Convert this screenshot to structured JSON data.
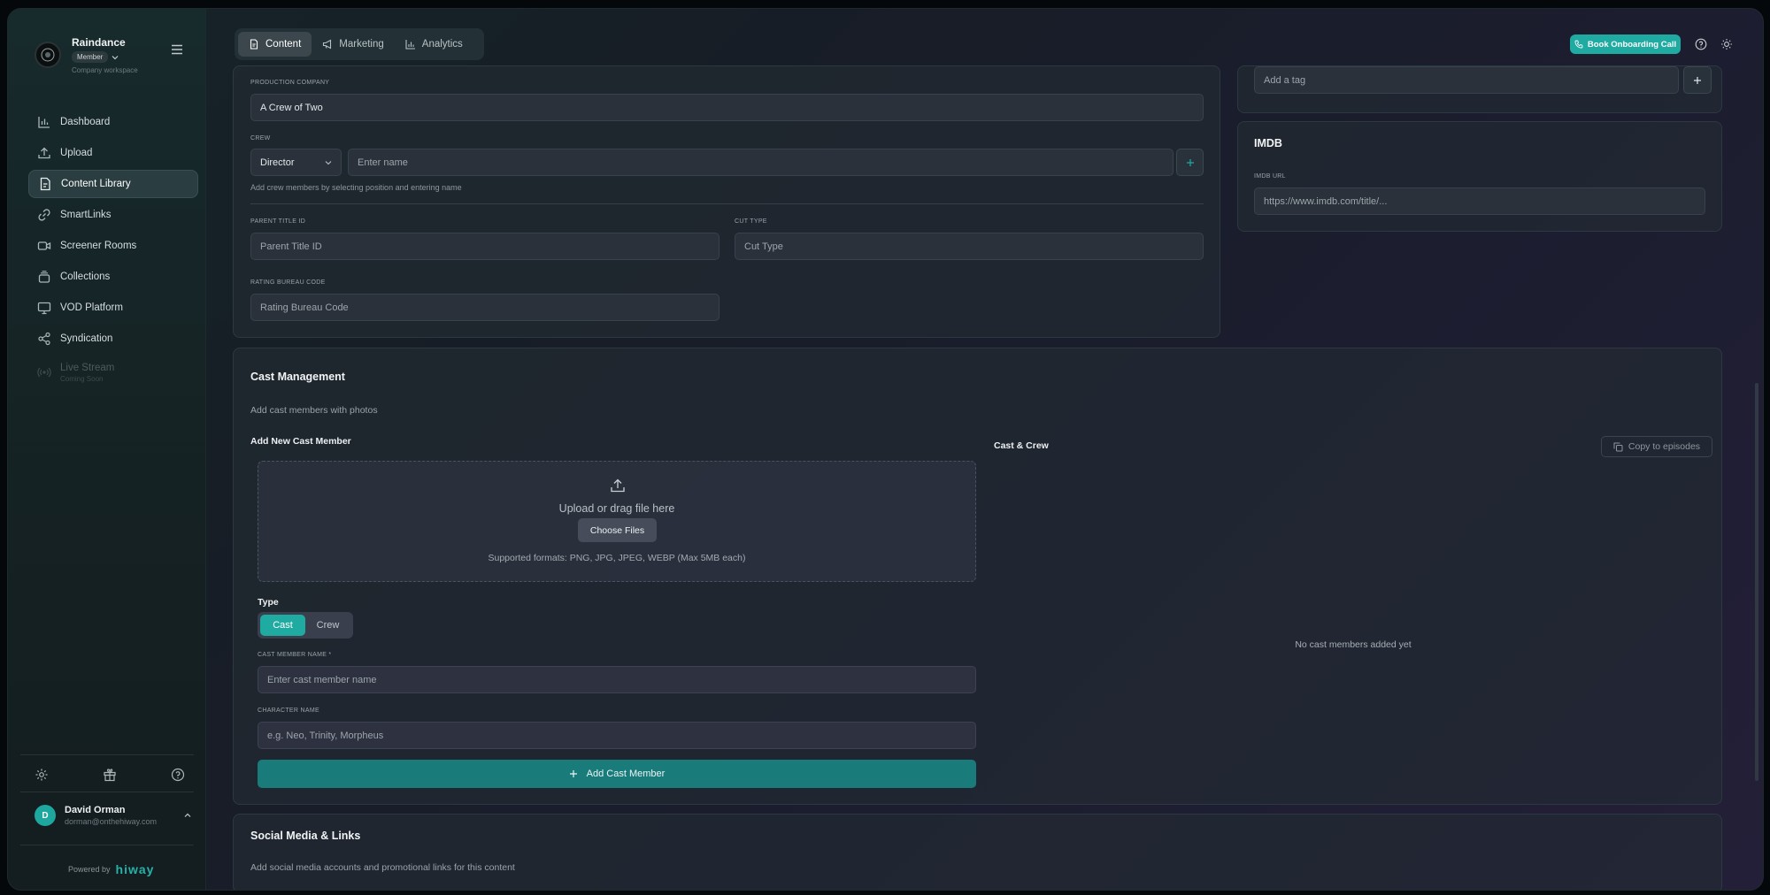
{
  "brand": {
    "name": "Raindance",
    "badge": "Member",
    "subtitle": "Company workspace"
  },
  "sidebar": {
    "items": [
      {
        "label": "Dashboard",
        "icon": "chart-bar-icon"
      },
      {
        "label": "Upload",
        "icon": "upload-icon"
      },
      {
        "label": "Content Library",
        "icon": "file-icon",
        "active": true
      },
      {
        "label": "SmartLinks",
        "icon": "link-icon"
      },
      {
        "label": "Screener Rooms",
        "icon": "video-icon"
      },
      {
        "label": "Collections",
        "icon": "layers-icon"
      },
      {
        "label": "VOD Platform",
        "icon": "monitor-icon"
      },
      {
        "label": "Syndication",
        "icon": "share-icon"
      },
      {
        "label": "Live Stream",
        "icon": "broadcast-icon",
        "disabled": true,
        "note": "Coming Soon"
      }
    ],
    "bottom_icons": [
      "settings-icon",
      "gift-icon",
      "help-icon"
    ]
  },
  "user": {
    "initial": "D",
    "name": "David Orman",
    "email": "dorman@onthehiway.com"
  },
  "powered": {
    "label": "Powered by",
    "brand": "hiway"
  },
  "topbar": {
    "tabs": [
      {
        "label": "Content",
        "icon": "file-icon",
        "active": true
      },
      {
        "label": "Marketing",
        "icon": "megaphone-icon"
      },
      {
        "label": "Analytics",
        "icon": "chart-bar-icon"
      }
    ],
    "onboarding_button": "Book Onboarding Call",
    "accent": "#1faaa2"
  },
  "details": {
    "production_company_label": "PRODUCTION COMPANY",
    "production_company_value": "A Crew of Two",
    "crew_label": "CREW",
    "crew_position": "Director",
    "crew_name_placeholder": "Enter name",
    "crew_hint": "Add crew members by selecting position and entering name",
    "parent_title_label": "PARENT TITLE ID",
    "parent_title_placeholder": "Parent Title ID",
    "cut_type_label": "CUT TYPE",
    "cut_type_placeholder": "Cut Type",
    "rating_label": "RATING BUREAU CODE",
    "rating_placeholder": "Rating Bureau Code"
  },
  "tags": {
    "placeholder": "Add a tag"
  },
  "imdb": {
    "title": "IMDB",
    "url_label": "IMDB URL",
    "url_placeholder": "https://www.imdb.com/title/..."
  },
  "cast": {
    "title": "Cast Management",
    "subtitle": "Add cast members with photos",
    "add_title": "Add New Cast Member",
    "upload_text": "Upload or drag file here",
    "choose_files": "Choose Files",
    "formats": "Supported formats: PNG, JPG, JPEG, WEBP (Max 5MB each)",
    "type_label": "Type",
    "type_options": [
      "Cast",
      "Crew"
    ],
    "name_label": "CAST MEMBER NAME *",
    "name_placeholder": "Enter cast member name",
    "character_label": "CHARACTER NAME",
    "character_placeholder": "e.g. Neo, Trinity, Morpheus",
    "add_button": "Add Cast Member",
    "list_title": "Cast & Crew",
    "copy_button": "Copy to episodes",
    "empty_text": "No cast members added yet"
  },
  "social": {
    "title": "Social Media & Links",
    "subtitle": "Add social media accounts and promotional links for this content"
  }
}
